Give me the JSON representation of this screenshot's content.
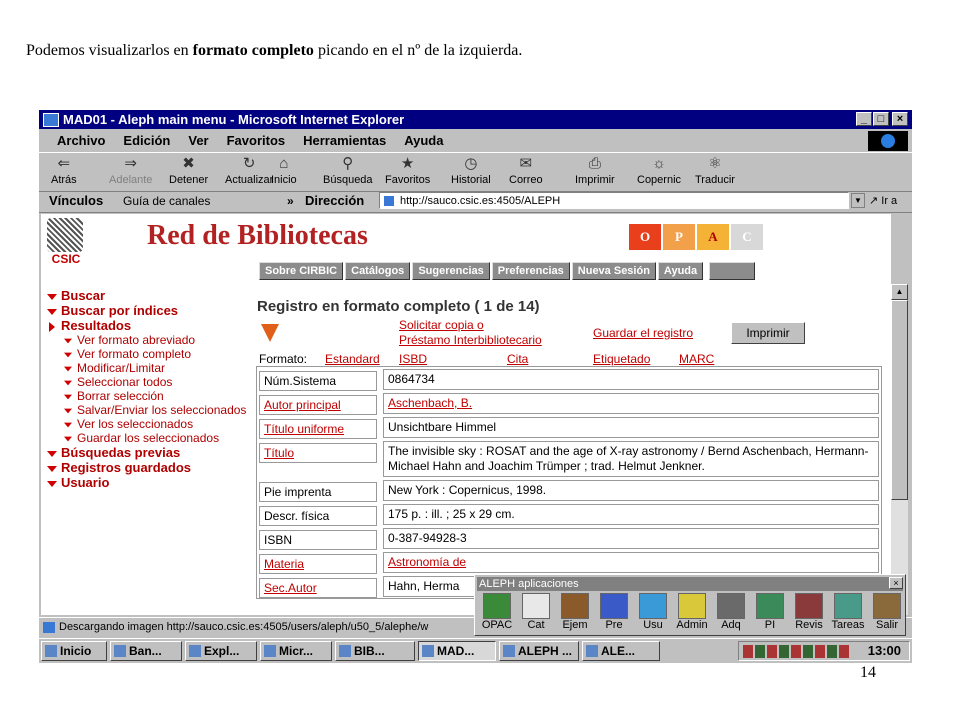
{
  "caption": {
    "part1": "Podemos visualizarlos en ",
    "bold": "formato completo",
    "part2": " picando en el nº de la izquierda."
  },
  "page_number": "14",
  "window": {
    "title": "MAD01 - Aleph main menu - Microsoft Internet Explorer",
    "menu": [
      "Archivo",
      "Edición",
      "Ver",
      "Favoritos",
      "Herramientas",
      "Ayuda"
    ],
    "toolbar": [
      "Atrás",
      "Adelante",
      "Detener",
      "Actualizar",
      "Inicio",
      "Búsqueda",
      "Favoritos",
      "Historial",
      "Correo",
      "Imprimir",
      "Copernic",
      "Traducir"
    ],
    "links_label": "Vínculos",
    "links_item": "Guía de canales",
    "address_label": "Dirección",
    "address": "http://sauco.csic.es:4505/ALEPH",
    "go_label": "Ir a",
    "status": "Descargando imagen http://sauco.csic.es:4505/users/aleph/u50_5/alephe/w"
  },
  "page": {
    "logo_text": "CSIC",
    "brand": "Red de Bibliotecas",
    "opac_letters": [
      {
        "t": "O",
        "bg": "#e8401c",
        "fg": "#ffffff"
      },
      {
        "t": "P",
        "bg": "#f2a14a",
        "fg": "#ffffff"
      },
      {
        "t": "A",
        "bg": "#f4b236",
        "fg": "#b00000"
      },
      {
        "t": "C",
        "bg": "#d8d8d8",
        "fg": "#ffffff"
      }
    ],
    "nav_tabs": [
      "Sobre CIRBIC",
      "Catálogos",
      "Sugerencias",
      "Preferencias",
      "Nueva Sesión",
      "Ayuda"
    ],
    "left_nav": {
      "buscar": "Buscar",
      "buscar_indices": "Buscar por índices",
      "resultados": "Resultados",
      "sub": [
        "Ver formato abreviado",
        "Ver formato completo",
        "Modificar/Limitar",
        "Seleccionar todos",
        "Borrar selección",
        "Salvar/Enviar los seleccionados",
        "Ver los seleccionados",
        "Guardar los seleccionados"
      ],
      "busquedas_previas": "Búsquedas previas",
      "registros_guardados": "Registros guardados",
      "usuario": "Usuario"
    },
    "heading": "Registro en formato completo ( 1 de 14)",
    "solicitar_1": "Solicitar copia o",
    "solicitar_2": "Préstamo Interbibliotecario",
    "guardar": "Guardar el registro",
    "imprimir": "Imprimir",
    "formato_label": "Formato:",
    "formats": [
      "Estandard",
      "ISBD",
      "Cita",
      "Etiquetado",
      "MARC"
    ],
    "record": [
      {
        "k": "Núm.Sistema",
        "v": "0864734",
        "link_k": false,
        "link_v": false
      },
      {
        "k": "Autor principal",
        "v": "Aschenbach, B.",
        "link_k": true,
        "link_v": true
      },
      {
        "k": "Título uniforme",
        "v": "Unsichtbare Himmel",
        "link_k": true,
        "link_v": false
      },
      {
        "k": "Título",
        "v": "The invisible sky : ROSAT and the age of X-ray astronomy / Bernd Aschenbach, Hermann-Michael Hahn and Joachim Trümper ; trad. Helmut Jenkner.",
        "link_k": true,
        "link_v": false
      },
      {
        "k": "Pie imprenta",
        "v": "New York : Copernicus, 1998.",
        "link_k": false,
        "link_v": false
      },
      {
        "k": "Descr. física",
        "v": "175 p. : ill. ; 25 x 29 cm.",
        "link_k": false,
        "link_v": false
      },
      {
        "k": "ISBN",
        "v": "0-387-94928-3",
        "link_k": false,
        "link_v": false
      },
      {
        "k": "Materia",
        "v": "Astronomía de",
        "link_k": true,
        "link_v": true
      },
      {
        "k": "Sec.Autor",
        "v": "Hahn, Herma",
        "link_k": true,
        "link_v": false
      }
    ]
  },
  "aleph_popup": {
    "title": "ALEPH aplicaciones",
    "buttons": [
      {
        "label": "OPAC",
        "color": "#3a8a3a"
      },
      {
        "label": "Cat",
        "color": "#e8e8e8"
      },
      {
        "label": "Ejem",
        "color": "#8a5a2a"
      },
      {
        "label": "Pre",
        "color": "#3a5ac8"
      },
      {
        "label": "Usu",
        "color": "#3a9ad8"
      },
      {
        "label": "Admin",
        "color": "#d8c83a"
      },
      {
        "label": "Adq",
        "color": "#6a6a6a"
      },
      {
        "label": "PI",
        "color": "#3a8a5a"
      },
      {
        "label": "Revis",
        "color": "#8a3a3a"
      },
      {
        "label": "Tareas",
        "color": "#4a9a8a"
      },
      {
        "label": "Salir",
        "color": "#8a6a3a"
      }
    ]
  },
  "taskbar": {
    "start": "Inicio",
    "items": [
      "Ban...",
      "Expl...",
      "Micr...",
      "BIB...",
      "MAD...",
      "ALEPH ...",
      "ALE..."
    ],
    "clock": "13:00"
  }
}
